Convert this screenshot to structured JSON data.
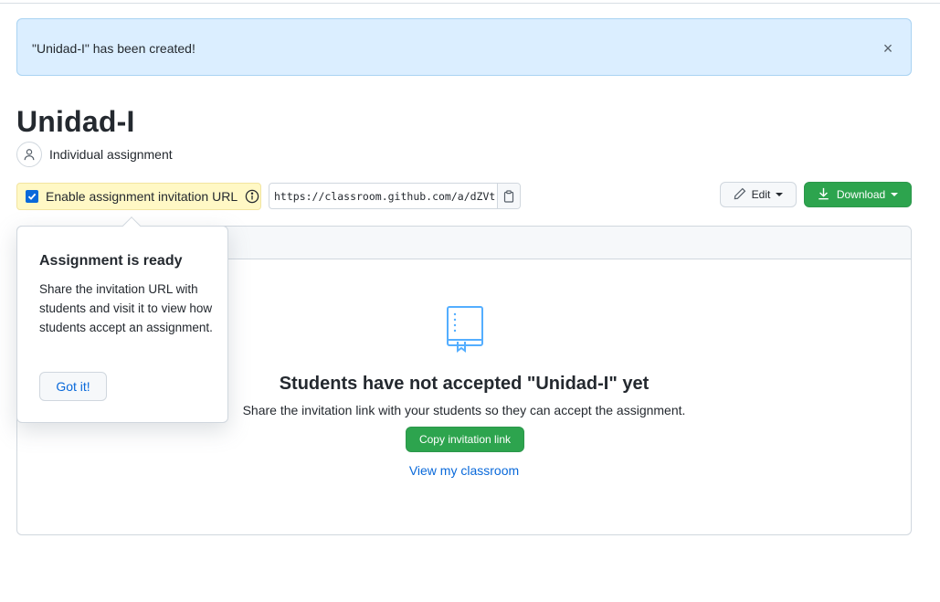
{
  "flash": {
    "message": "\"Unidad-I\" has been created!",
    "close_symbol": "×"
  },
  "assignment": {
    "title": "Unidad-I",
    "type": "Individual assignment"
  },
  "invitation": {
    "enable_label": "Enable assignment invitation URL",
    "enabled": true,
    "url": "https://classroom.github.com/a/dZVt"
  },
  "toolbar": {
    "edit_label": "Edit",
    "download_label": "Download"
  },
  "empty_state": {
    "title": "Students have not accepted \"Unidad-I\" yet",
    "description": "Share the invitation link with your students so they can accept the assignment.",
    "copy_button": "Copy invitation link",
    "view_link": "View my classroom"
  },
  "popover": {
    "title": "Assignment is ready",
    "body": "Share the invitation URL with students and visit it to view how students accept an assignment.",
    "button": "Got it!"
  },
  "colors": {
    "accent_blue": "#0969da",
    "primary_green": "#2da44e",
    "flash_bg": "#dbeeff",
    "highlight_yellow": "#fff8c5"
  },
  "icons": [
    "close-icon",
    "person-icon",
    "info-icon",
    "clipboard-icon",
    "pencil-icon",
    "download-icon",
    "book-icon"
  ]
}
